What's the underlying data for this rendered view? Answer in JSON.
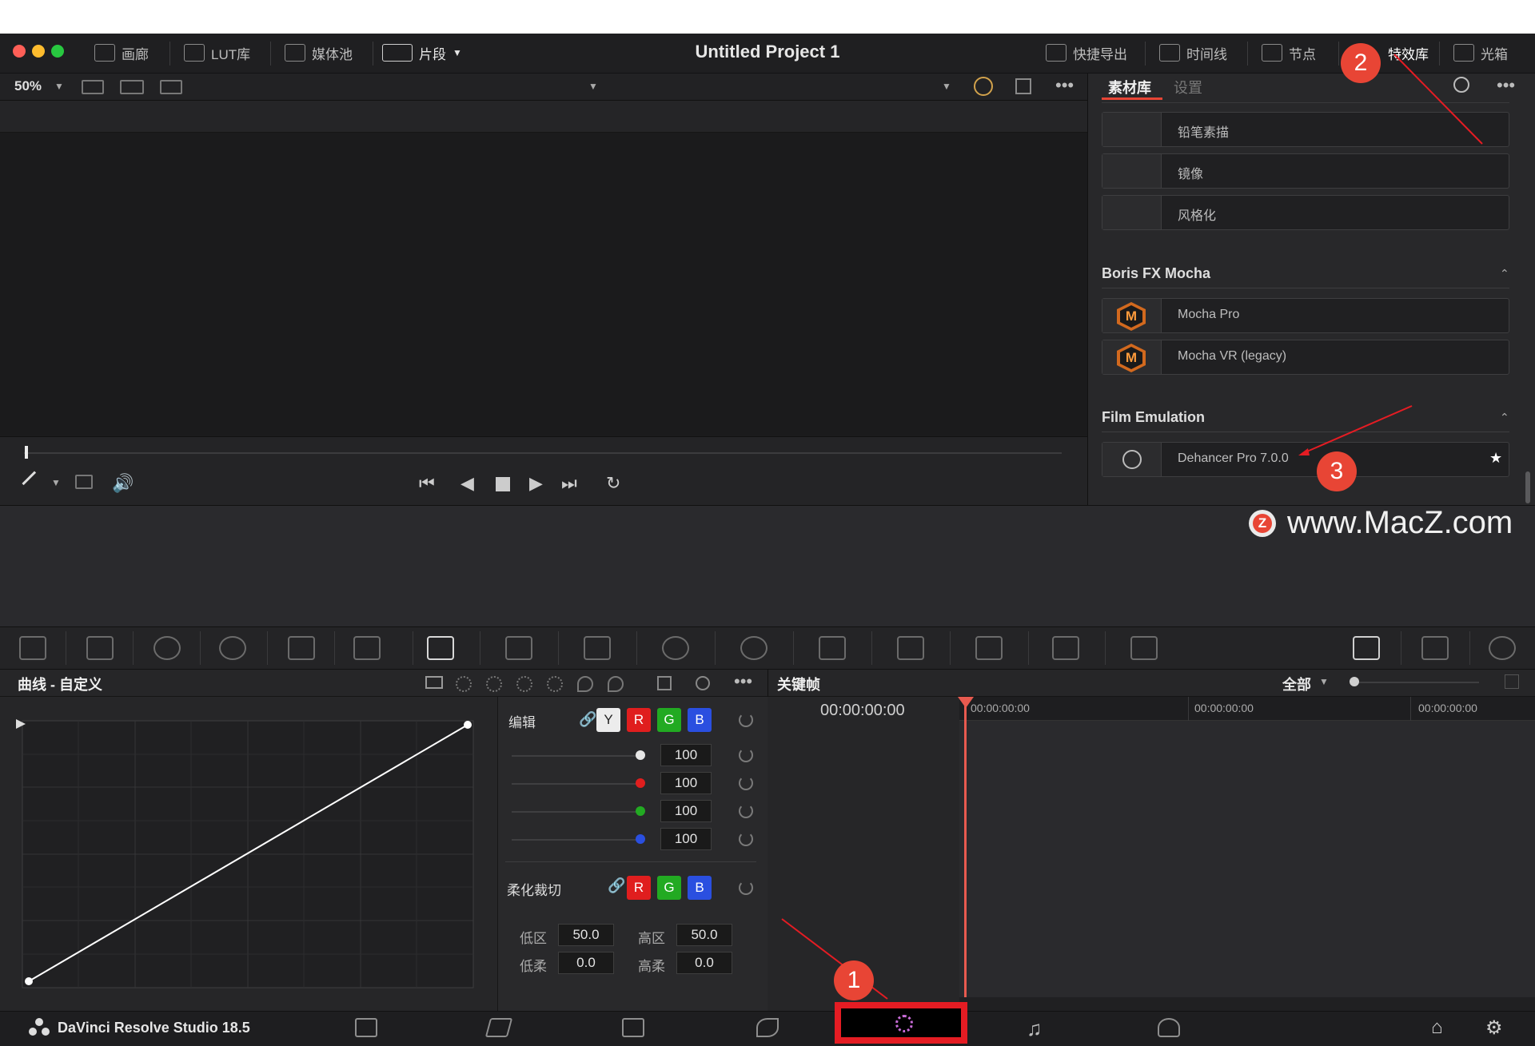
{
  "window": {
    "title": "Untitled Project 1"
  },
  "titlebar": {
    "left_items": [
      {
        "label": "画廊",
        "icon": "gallery-icon"
      },
      {
        "label": "LUT库",
        "icon": "lut-icon"
      },
      {
        "label": "媒体池",
        "icon": "media-pool-icon"
      },
      {
        "label": "片段",
        "icon": "clips-icon"
      }
    ],
    "right_items": [
      {
        "label": "快捷导出",
        "icon": "export-icon"
      },
      {
        "label": "时间线",
        "icon": "timeline-icon"
      },
      {
        "label": "节点",
        "icon": "nodes-icon"
      },
      {
        "label": "特效库",
        "icon": "effects-icon"
      },
      {
        "label": "光箱",
        "icon": "lightbox-icon"
      }
    ]
  },
  "viewer": {
    "zoom": "50%"
  },
  "effects_panel": {
    "tabs": [
      "素材库",
      "设置"
    ],
    "active_tab": "素材库",
    "items_top": [
      "铅笔素描",
      "镜像",
      "风格化"
    ],
    "sections": [
      {
        "title": "Boris FX Mocha",
        "items": [
          "Mocha Pro",
          "Mocha VR (legacy)"
        ]
      },
      {
        "title": "Film Emulation",
        "items": [
          "Dehancer Pro 7.0.0"
        ]
      }
    ]
  },
  "watermark": {
    "text": "www.MacZ.com",
    "logo": "Z"
  },
  "curves": {
    "title": "曲线 - 自定义",
    "edit_label": "编辑",
    "channels": [
      "Y",
      "R",
      "G",
      "B"
    ],
    "values": [
      "100",
      "100",
      "100",
      "100"
    ],
    "soft_clip_label": "柔化裁切",
    "soft_clip_channels": [
      "R",
      "G",
      "B"
    ],
    "low_label": "低区",
    "low_value": "50.0",
    "high_label": "高区",
    "high_value": "50.0",
    "low_soft_label": "低柔",
    "low_soft_value": "0.0",
    "high_soft_label": "高柔",
    "high_soft_value": "0.0"
  },
  "keyframes": {
    "title": "关键帧",
    "filter": "全部",
    "current_time": "00:00:00:00",
    "ruler": [
      "00:00:00:00",
      "00:00:00:00",
      "00:00:00:00"
    ]
  },
  "bottom": {
    "app_name": "DaVinci Resolve Studio 18.5"
  },
  "annotations": [
    "1",
    "2",
    "3"
  ],
  "colors": {
    "accent_red": "#e84535",
    "channel_red": "#e01e1e",
    "channel_green": "#22aa22",
    "channel_blue": "#2a4fe0",
    "playhead": "#e85a4f"
  }
}
